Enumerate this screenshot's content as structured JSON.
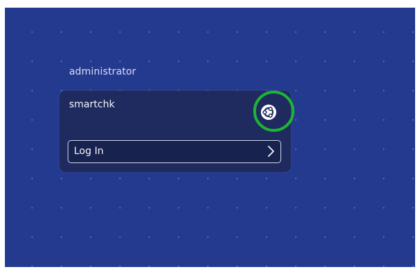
{
  "users": {
    "other_user": "administrator",
    "selected_user": "smartchk"
  },
  "login": {
    "button_label": "Log In"
  },
  "icons": {
    "session": "ubuntu-session-icon",
    "submit": "chevron-right-icon"
  },
  "colors": {
    "background": "#243a8f",
    "card": "#1f2b5f",
    "highlight": "#1db534"
  }
}
